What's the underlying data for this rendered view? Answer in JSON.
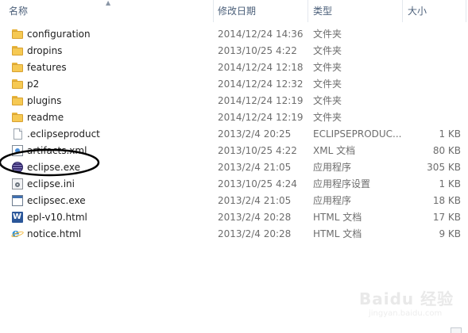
{
  "columns": {
    "name": "名称",
    "date": "修改日期",
    "type": "类型",
    "size": "大小"
  },
  "files": [
    {
      "name": "configuration",
      "date": "2014/12/24 14:36",
      "type": "文件夹",
      "size": "",
      "icon": "folder-icon"
    },
    {
      "name": "dropins",
      "date": "2013/10/25 4:22",
      "type": "文件夹",
      "size": "",
      "icon": "folder-icon"
    },
    {
      "name": "features",
      "date": "2014/12/24 12:18",
      "type": "文件夹",
      "size": "",
      "icon": "folder-icon"
    },
    {
      "name": "p2",
      "date": "2014/12/24 12:32",
      "type": "文件夹",
      "size": "",
      "icon": "folder-icon"
    },
    {
      "name": "plugins",
      "date": "2014/12/24 12:19",
      "type": "文件夹",
      "size": "",
      "icon": "folder-icon"
    },
    {
      "name": "readme",
      "date": "2014/12/24 12:19",
      "type": "文件夹",
      "size": "",
      "icon": "folder-icon"
    },
    {
      "name": ".eclipseproduct",
      "date": "2013/2/4 20:25",
      "type": "ECLIPSEPRODUC...",
      "size": "1 KB",
      "icon": "file-icon"
    },
    {
      "name": "artifacts.xml",
      "date": "2013/10/25 4:22",
      "type": "XML 文档",
      "size": "80 KB",
      "icon": "xml-icon"
    },
    {
      "name": "eclipse.exe",
      "date": "2013/2/4 21:05",
      "type": "应用程序",
      "size": "305 KB",
      "icon": "eclipse-exe-icon"
    },
    {
      "name": "eclipse.ini",
      "date": "2013/10/25 4:24",
      "type": "应用程序设置",
      "size": "1 KB",
      "icon": "settings-file-icon"
    },
    {
      "name": "eclipsec.exe",
      "date": "2013/2/4 21:05",
      "type": "应用程序",
      "size": "18 KB",
      "icon": "application-icon"
    },
    {
      "name": "epl-v10.html",
      "date": "2013/2/4 20:28",
      "type": "HTML 文档",
      "size": "17 KB",
      "icon": "word-html-icon"
    },
    {
      "name": "notice.html",
      "date": "2013/2/4 20:28",
      "type": "HTML 文档",
      "size": "9 KB",
      "icon": "ie-html-icon"
    }
  ],
  "watermark": {
    "text": "Baidu 经验",
    "sub": "jingyan.baidu.com"
  },
  "colors": {
    "header_text": "#4c607a",
    "folder": "#f6c953",
    "annotation": "#000000"
  }
}
